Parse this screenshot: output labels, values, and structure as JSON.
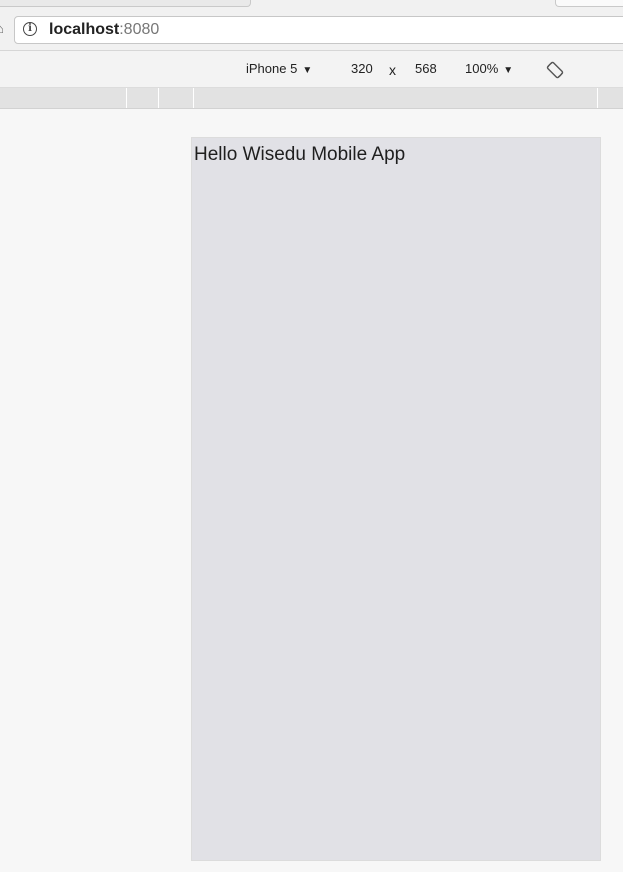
{
  "browser": {
    "address_bar": {
      "host": "localhost",
      "port": ":8080"
    }
  },
  "device_toolbar": {
    "device": "iPhone 5",
    "width": "320",
    "separator": "x",
    "height": "568",
    "zoom": "100%",
    "caret": "▼"
  },
  "page": {
    "text": "Hello Wisedu Mobile App"
  },
  "icons": {
    "home": "home-icon",
    "info": "info-icon",
    "rotate": "rotate-icon",
    "dropdown": "caret-down-icon"
  },
  "colors": {
    "device_screen_background": "#e1e1e6",
    "viewport_background": "#f7f7f7",
    "ruler_background": "#e2e2e2"
  }
}
